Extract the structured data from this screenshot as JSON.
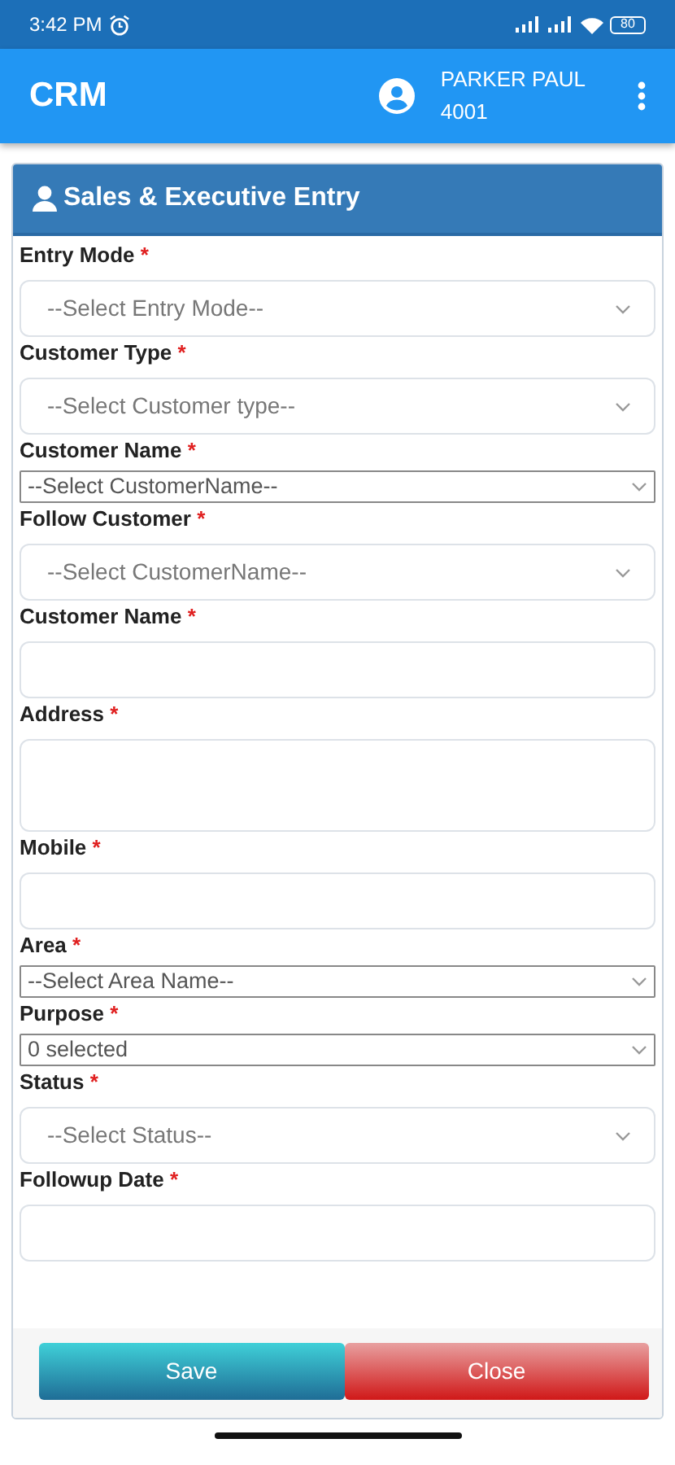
{
  "status_bar": {
    "time": "3:42 PM",
    "battery": "80"
  },
  "app_bar": {
    "title": "CRM",
    "user_name": "PARKER PAUL",
    "user_id": "4001"
  },
  "form": {
    "title": "Sales & Executive Entry",
    "fields": [
      {
        "label": "Entry Mode",
        "mark": "*",
        "kind": "select",
        "placeholder": "--Select Entry Mode--"
      },
      {
        "label": "Customer Type",
        "mark": "*",
        "kind": "select",
        "placeholder": "--Select Customer type--"
      },
      {
        "label": "Customer Name",
        "mark": "*",
        "kind": "plain-select",
        "value": "--Select CustomerName--"
      },
      {
        "label": "Follow Customer",
        "mark": "*",
        "kind": "select",
        "placeholder": "--Select CustomerName--"
      },
      {
        "label": "Customer Name",
        "mark": "*",
        "kind": "input"
      },
      {
        "label": "Address",
        "mark": "*",
        "kind": "textarea"
      },
      {
        "label": "Mobile",
        "mark": "*",
        "kind": "input"
      },
      {
        "label": "Area",
        "mark": "*",
        "kind": "plain-select",
        "value": "--Select Area Name--"
      },
      {
        "label": "Purpose",
        "mark": "*",
        "kind": "plain-select",
        "value": "0 selected"
      },
      {
        "label": "Status",
        "mark": "*",
        "kind": "select",
        "placeholder": "--Select Status--"
      },
      {
        "label": "Followup Date",
        "mark": "*",
        "kind": "input"
      }
    ],
    "buttons": [
      {
        "label": "Save",
        "kind": "save"
      },
      {
        "label": "Close",
        "kind": "close"
      }
    ]
  }
}
